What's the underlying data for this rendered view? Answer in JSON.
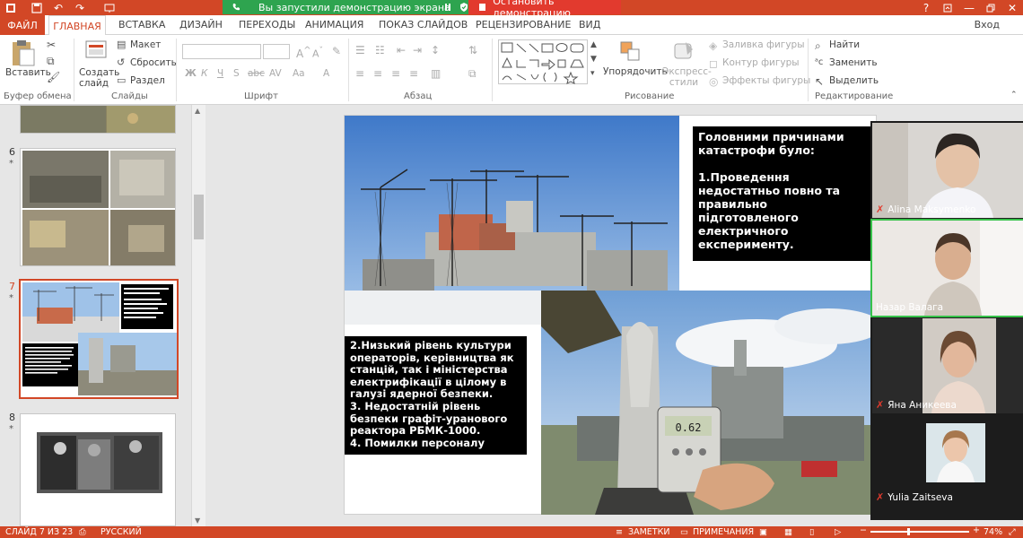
{
  "titlebar": {
    "share_banner": "Вы запустили демонстрацию экрана",
    "stop_share": "Остановить демонстрацию",
    "help": "?"
  },
  "tabs": [
    {
      "label": "ФАЙЛ"
    },
    {
      "label": "ГЛАВНАЯ"
    },
    {
      "label": "ВСТАВКА"
    },
    {
      "label": "ДИЗАЙН"
    },
    {
      "label": "ПЕРЕХОДЫ"
    },
    {
      "label": "АНИМАЦИЯ"
    },
    {
      "label": "ПОКАЗ СЛАЙДОВ"
    },
    {
      "label": "РЕЦЕНЗИРОВАНИЕ"
    },
    {
      "label": "ВИД"
    }
  ],
  "signin": "Вход",
  "ribbon": {
    "clipboard": {
      "paste": "Вставить",
      "label": "Буфер обмена"
    },
    "slides": {
      "new_slide": "Создать слайд",
      "layout": "Макет",
      "reset": "Сбросить",
      "section": "Раздел",
      "label": "Слайды"
    },
    "font": {
      "label": "Шрифт",
      "bold": "Ж",
      "italic": "К",
      "underline": "Ч",
      "strike": "S",
      "shadow": "abc",
      "spacing": "AV",
      "case": "Aa",
      "color": "A"
    },
    "paragraph": {
      "label": "Абзац"
    },
    "drawing": {
      "arrange": "Упорядочить",
      "quick_styles": "Экспресс-стили",
      "fill": "Заливка фигуры",
      "outline": "Контур фигуры",
      "effects": "Эффекты фигуры",
      "label": "Рисование"
    },
    "editing": {
      "find": "Найти",
      "replace": "Заменить",
      "select": "Выделить",
      "label": "Редактирование"
    }
  },
  "thumbnails": [
    {
      "number": "6",
      "star": "*"
    },
    {
      "number": "7",
      "star": "*"
    },
    {
      "number": "8",
      "star": "*"
    }
  ],
  "slide": {
    "box1": {
      "heading": "Головними причинами катастрофи було:",
      "item1": "1.Проведення недостатньо повно та правильно підготовленого електричного експерименту."
    },
    "box2": {
      "item2": "2.Низький рівень культури операторів, керівництва як станцій, так і міністерства електрифікації в цілому в галузі ядерної безпеки.",
      "item3": "3. Недостатній рівень безпеки графіт-уранового реактора РБМК-1000.",
      "item4": "4. Помилки персоналу"
    }
  },
  "participants": [
    {
      "name": "Alina Maksymenko"
    },
    {
      "name": "Назар Валага"
    },
    {
      "name": "Яна Аникеева"
    },
    {
      "name": "Yulia Zaitseva"
    }
  ],
  "statusbar": {
    "slide_info": "СЛАЙД 7 ИЗ 23",
    "language": "РУССКИЙ",
    "notes": "ЗАМЕТКИ",
    "comments": "ПРИМЕЧАНИЯ",
    "zoom_minus": "−",
    "zoom_plus": "+",
    "zoom": "74%",
    "zoom_fraction": 0.74
  },
  "colors": {
    "brand": "#d24726",
    "share_green": "#2ea44f",
    "stop_red": "#e23a2e",
    "active_speaker": "#37c24a"
  }
}
